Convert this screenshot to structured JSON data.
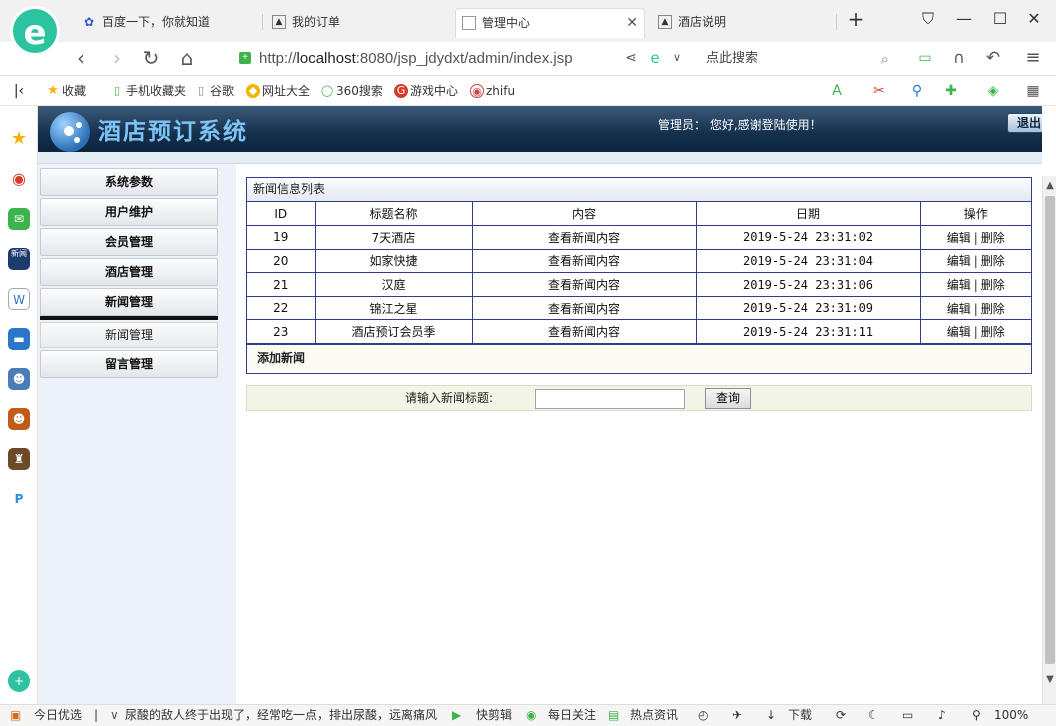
{
  "browser": {
    "tabs": [
      {
        "label": "百度一下，你就知道",
        "icon": "baidu-paw-icon"
      },
      {
        "label": "我的订单",
        "icon": "image-icon"
      },
      {
        "label": "管理中心",
        "icon": "page-icon"
      },
      {
        "label": "酒店说明",
        "icon": "image-icon"
      }
    ],
    "new_tab": "+",
    "url": {
      "scheme": "http://",
      "host": "localhost",
      "rest": ":8080/jsp_jdydxt/admin/index.jsp"
    },
    "search_placeholder": "点此搜索",
    "bookmarks": [
      {
        "label": "收藏",
        "icon": "star-icon"
      },
      {
        "label": "手机收藏夹",
        "icon": "phone-icon"
      },
      {
        "label": "谷歌",
        "icon": "page-icon"
      },
      {
        "label": "网址大全",
        "icon": "web-directory-icon"
      },
      {
        "label": "360搜索",
        "icon": "search-360-icon"
      },
      {
        "label": "游戏中心",
        "icon": "game-center-icon"
      },
      {
        "label": "zhifu",
        "icon": "zhifu-icon"
      }
    ],
    "status": {
      "today": "今日优选",
      "news": "尿酸的敌人终于出现了，经常吃一点，排出尿酸，远离痛风",
      "clip": "快剪辑",
      "daily": "每日关注",
      "hot": "热点资讯",
      "download": "下载",
      "zoom": "100%"
    }
  },
  "site": {
    "title": "酒店预订系统",
    "welcome": "管理员： 您好,感谢登陆使用！",
    "logout": "退出"
  },
  "menu": {
    "items": [
      "系统参数",
      "用户维护",
      "会员管理",
      "酒店管理",
      "新闻管理"
    ],
    "submenu": [
      "新闻管理"
    ],
    "bottom": "留言管理"
  },
  "news": {
    "box_title": "新闻信息列表",
    "columns": [
      "ID",
      "标题名称",
      "内容",
      "日期",
      "操作"
    ],
    "rows": [
      {
        "id": "19",
        "title": "7天酒店",
        "content": "查看新闻内容",
        "date": "2019-5-24 23:31:02"
      },
      {
        "id": "20",
        "title": "如家快捷",
        "content": "查看新闻内容",
        "date": "2019-5-24 23:31:04"
      },
      {
        "id": "21",
        "title": "汉庭",
        "content": "查看新闻内容",
        "date": "2019-5-24 23:31:06"
      },
      {
        "id": "22",
        "title": "锦江之星",
        "content": "查看新闻内容",
        "date": "2019-5-24 23:31:09"
      },
      {
        "id": "23",
        "title": "酒店预订会员季",
        "content": "查看新闻内容",
        "date": "2019-5-24 23:31:11"
      }
    ],
    "edit": "编辑",
    "delete": "删除",
    "add": "添加新闻"
  },
  "search": {
    "label": "请输入新闻标题:",
    "value": "",
    "button": "查询"
  }
}
